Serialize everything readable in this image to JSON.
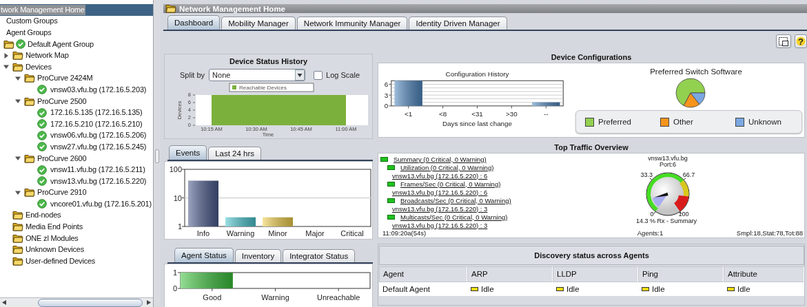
{
  "tree": {
    "root": {
      "label": "twork Management Home",
      "selected": true
    },
    "items": [
      {
        "label": "Custom Groups",
        "kind": "group",
        "selected": false
      },
      {
        "label": "Agent Groups",
        "kind": "group",
        "selected": false
      },
      {
        "label": "Default Agent Group",
        "kind": "agent-group",
        "selected": false
      },
      {
        "label": "Network Map",
        "kind": "folder",
        "selected": false,
        "expanded": false
      },
      {
        "label": "Devices",
        "kind": "folder",
        "selected": false,
        "expanded": true,
        "children": [
          {
            "label": "ProCurve 2424M",
            "kind": "folder",
            "selected": false,
            "expanded": true,
            "children": [
              {
                "label": "vnsw03.vfu.bg (172.16.5.203)",
                "kind": "device",
                "selected": false
              }
            ]
          },
          {
            "label": "ProCurve 2500",
            "kind": "folder",
            "selected": false,
            "expanded": true,
            "children": [
              {
                "label": "172.16.5.135 (172.16.5.135)",
                "kind": "device",
                "selected": false
              },
              {
                "label": "172.16.5.210 (172.16.5.210)",
                "kind": "device",
                "selected": false
              },
              {
                "label": "vnsw06.vfu.bg (172.16.5.206)",
                "kind": "device",
                "selected": false
              },
              {
                "label": "vnsw27.vfu.bg (172.16.5.245)",
                "kind": "device",
                "selected": false
              }
            ]
          },
          {
            "label": "ProCurve 2600",
            "kind": "folder",
            "selected": false,
            "expanded": true,
            "children": [
              {
                "label": "vnsw11.vfu.bg (172.16.5.211)",
                "kind": "device",
                "selected": false
              },
              {
                "label": "vnsw13.vfu.bg (172.16.5.220)",
                "kind": "device",
                "selected": false
              }
            ]
          },
          {
            "label": "ProCurve 2910",
            "kind": "folder",
            "selected": false,
            "expanded": true,
            "children": [
              {
                "label": "vncore01.vfu.bg (172.16.5.201)",
                "kind": "device",
                "selected": false
              }
            ]
          }
        ]
      },
      {
        "label": "End-nodes",
        "kind": "folder",
        "selected": false
      },
      {
        "label": "Media End Points",
        "kind": "folder",
        "selected": false
      },
      {
        "label": "ONE zl Modules",
        "kind": "folder",
        "selected": false
      },
      {
        "label": "Unknown Devices",
        "kind": "folder",
        "selected": false
      },
      {
        "label": "User-defined Devices",
        "kind": "folder",
        "selected": false
      }
    ]
  },
  "title_bar": {
    "title": "Network Management Home"
  },
  "main_tabs": [
    {
      "label": "Dashboard",
      "selected": true
    },
    {
      "label": "Mobility Manager",
      "selected": false
    },
    {
      "label": "Network Immunity Manager",
      "selected": false
    },
    {
      "label": "Identity Driven Manager",
      "selected": false
    }
  ],
  "toolbar": {
    "help_label": "?"
  },
  "device_status_history": {
    "split_by_label": "Split by",
    "split_by_value": "None",
    "log_scale_label": "Log Scale",
    "log_scale_checked": false,
    "chart_data": {
      "type": "area",
      "title": "Device Status History",
      "xlabel": "Time",
      "ylabel": "Devices",
      "x": [
        "10:15 AM",
        "10:30 AM",
        "10:45 AM",
        "11:00 AM"
      ],
      "series": [
        {
          "name": "Reachable Devices",
          "color": "#7cb03c",
          "values": [
            8,
            8,
            8,
            8
          ]
        }
      ],
      "ylim": [
        0,
        8
      ],
      "yticks": [
        0,
        2,
        4,
        6,
        8
      ]
    }
  },
  "event_tabs": [
    {
      "label": "Events",
      "selected": true
    },
    {
      "label": "Last 24 hrs",
      "selected": false
    }
  ],
  "events_chart": {
    "axis_labels": [
      "100",
      "10",
      "1"
    ],
    "categories": [
      "Info",
      "Warning",
      "Minor",
      "Major",
      "Critical"
    ]
  },
  "agent_tabs": [
    {
      "label": "Agent Status",
      "selected": true
    },
    {
      "label": "Inventory",
      "selected": false
    },
    {
      "label": "Integrator Status",
      "selected": false
    }
  ],
  "agent_status_chart": {
    "chart_data": {
      "type": "bar",
      "categories": [
        "Good",
        "Warning",
        "Unreachable"
      ],
      "values": [
        1,
        0,
        0
      ],
      "ylim": [
        0,
        1
      ],
      "yticks": [
        0,
        1
      ]
    }
  },
  "device_configurations": {
    "title": "Device Configurations",
    "configuration_history": {
      "chart_data": {
        "type": "bar",
        "title": "Configuration History",
        "xlabel": "Days since last change",
        "categories": [
          "<1",
          "<8",
          "<31",
          ">30",
          "--"
        ],
        "values": [
          7,
          0,
          0,
          0,
          1
        ],
        "ylim": [
          0,
          7
        ],
        "yticks": [
          0,
          3,
          6
        ]
      }
    },
    "preferred_switch_software": {
      "title": "Preferred Switch Software",
      "legend": [
        {
          "label": "Preferred",
          "color": "#92d050"
        },
        {
          "label": "Other",
          "color": "#f7941d"
        },
        {
          "label": "Unknown",
          "color": "#7ba7e1"
        }
      ]
    }
  },
  "top_traffic": {
    "title": "Top Traffic Overview",
    "items": [
      {
        "label": "Summary (0 Critical, 0 Warning)",
        "children": [
          {
            "label": "Utilization (0 Critical, 0 Warning)",
            "detail": "vnsw13.vfu.bg (172.16.5.220) : 6"
          },
          {
            "label": "Frames/Sec (0 Critical, 0 Warning)",
            "detail": "vnsw13.vfu.bg (172.16.5.220) : 6"
          },
          {
            "label": "Broadcasts/Sec (0 Critical, 0 Warning)",
            "detail": "vnsw13.vfu.bg (172.16.5.220) : 3"
          },
          {
            "label": "Multicasts/Sec (0 Critical, 0 Warning)",
            "detail": "vnsw13.vfu.bg (172.16.5.220) : 3"
          }
        ]
      }
    ],
    "gauge": {
      "device": "vnsw13.vfu.bg",
      "port": "Port:6",
      "scale_labels": [
        "33.3",
        "66.7",
        "0",
        "100"
      ],
      "reading": "14.3 % Rx - Summary"
    },
    "footer": {
      "time": "11:09:20a(54s)",
      "agents": "Agents:1",
      "stats": "Smpl:18,Stat:78,Tot:88"
    }
  },
  "discovery": {
    "title": "Discovery status across Agents",
    "columns": [
      "Agent",
      "ARP",
      "LLDP",
      "Ping",
      "Attribute"
    ],
    "rows": [
      [
        "Default Agent",
        "Idle",
        "Idle",
        "Idle",
        "Idle"
      ]
    ]
  }
}
